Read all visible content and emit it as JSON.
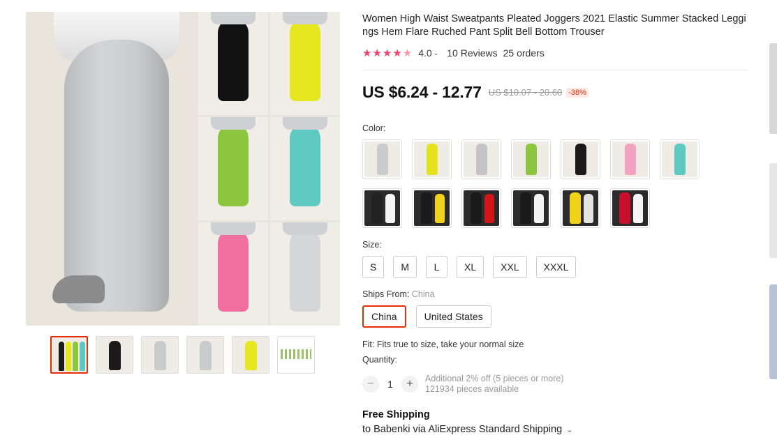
{
  "product": {
    "title": "Women High Waist Sweatpants Pleated Joggers 2021 Elastic Summer Stacked Leggings Hem Flare Ruched Pant Split Bell Bottom Trouser",
    "rating": "4.0",
    "rating_chevron": "⌄",
    "reviews": "10 Reviews",
    "orders": "25 orders",
    "stars": "★★★★",
    "half_star": "★"
  },
  "price": {
    "current": "US $6.24 - 12.77",
    "original": "US $10.07 - 20.60",
    "discount": "-38%"
  },
  "gallery": {
    "main_colors": [
      "#111111",
      "#e6e61e",
      "#8cc63f",
      "#5ec9c0",
      "#f06f9e",
      "#d4d6d8"
    ],
    "thumbnails": [
      {
        "kind": "collage",
        "color": "#8cc63f"
      },
      {
        "kind": "single",
        "color": "#1a1a1a"
      },
      {
        "kind": "single",
        "color": "#c8cacc"
      },
      {
        "kind": "single",
        "color": "#c8cacc"
      },
      {
        "kind": "single",
        "color": "#e6e61e"
      },
      {
        "kind": "chart",
        "color": "#9fc06b"
      }
    ]
  },
  "color": {
    "label": "Color:",
    "swatches_row1": [
      "#c9cbcd",
      "#e6e31e",
      "#c2c4c6",
      "#8cc63f",
      "#1a1a1a",
      "#f3a2c0",
      "#5ec9c0"
    ],
    "swatches_row2": [
      {
        "a": "#222222",
        "b": "#f4f4f4"
      },
      {
        "a": "#1a1a1a",
        "b": "#f1d21a"
      },
      {
        "a": "#1a1a1a",
        "b": "#d0151b"
      },
      {
        "a": "#1a1a1a",
        "b": "#f4f4f4"
      },
      {
        "a": "#f1d21a",
        "b": "#e3e3e3"
      },
      {
        "a": "#c8102e",
        "b": "#f4f4f4"
      }
    ]
  },
  "size": {
    "label": "Size:",
    "options": [
      "S",
      "M",
      "L",
      "XL",
      "XXL",
      "XXXL"
    ]
  },
  "ships_from": {
    "label": "Ships From:",
    "value": "China",
    "options": [
      "China",
      "United States"
    ],
    "selected": "China"
  },
  "fit": "Fit: Fits true to size, take your normal size",
  "quantity": {
    "label": "Quantity:",
    "value": "1",
    "minus": "−",
    "plus": "+",
    "discount_note": "Additional 2% off (5 pieces or more)",
    "available": "121934 pieces available"
  },
  "shipping": {
    "title": "Free Shipping",
    "detail": "to Babenki via AliExpress Standard Shipping",
    "chevron": "⌄"
  },
  "colors": {
    "accent": "#e62e04",
    "star": "#f2416b"
  }
}
